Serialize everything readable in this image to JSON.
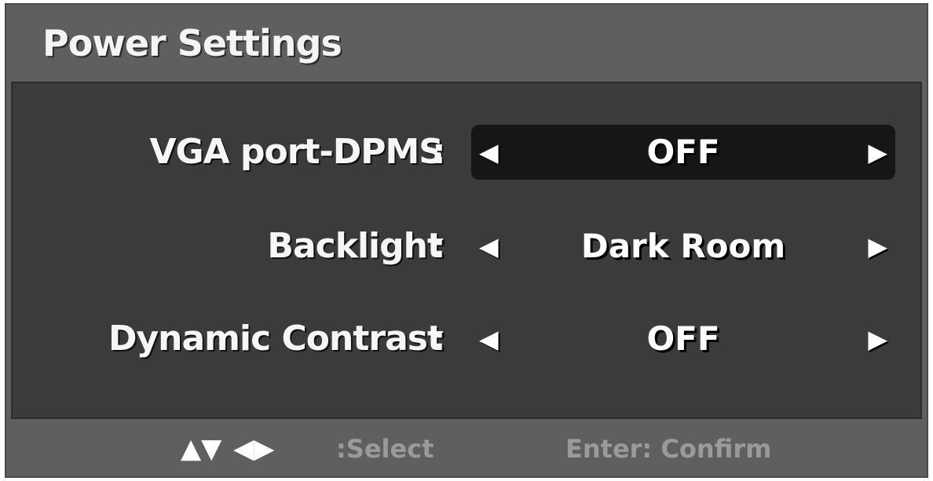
{
  "menu": {
    "title": "Power Settings"
  },
  "rows": [
    {
      "label": "VGA port-DPMS",
      "colon": ":",
      "value": "OFF",
      "active": true
    },
    {
      "label": "Backlight",
      "colon": ":",
      "value": "Dark Room",
      "active": false
    },
    {
      "label": "Dynamic Contrast",
      "colon": ":",
      "value": "OFF",
      "active": false
    }
  ],
  "arrows": {
    "left": "◀",
    "right": "▶"
  },
  "footer": {
    "keys": {
      "up_down": "▲▼",
      "left_right": "◀▶"
    },
    "select_text": ":Select",
    "confirm_text": "Enter: Confirm"
  },
  "colors": {
    "frame": "#5f5f5f",
    "panel": "#3b3b3b",
    "highlight": "#161616",
    "hint_text": "#9a9a9a"
  },
  "icons": {
    "left": "left-triangle-icon",
    "right": "right-triangle-icon",
    "nav": "arrow-keys-icon"
  }
}
